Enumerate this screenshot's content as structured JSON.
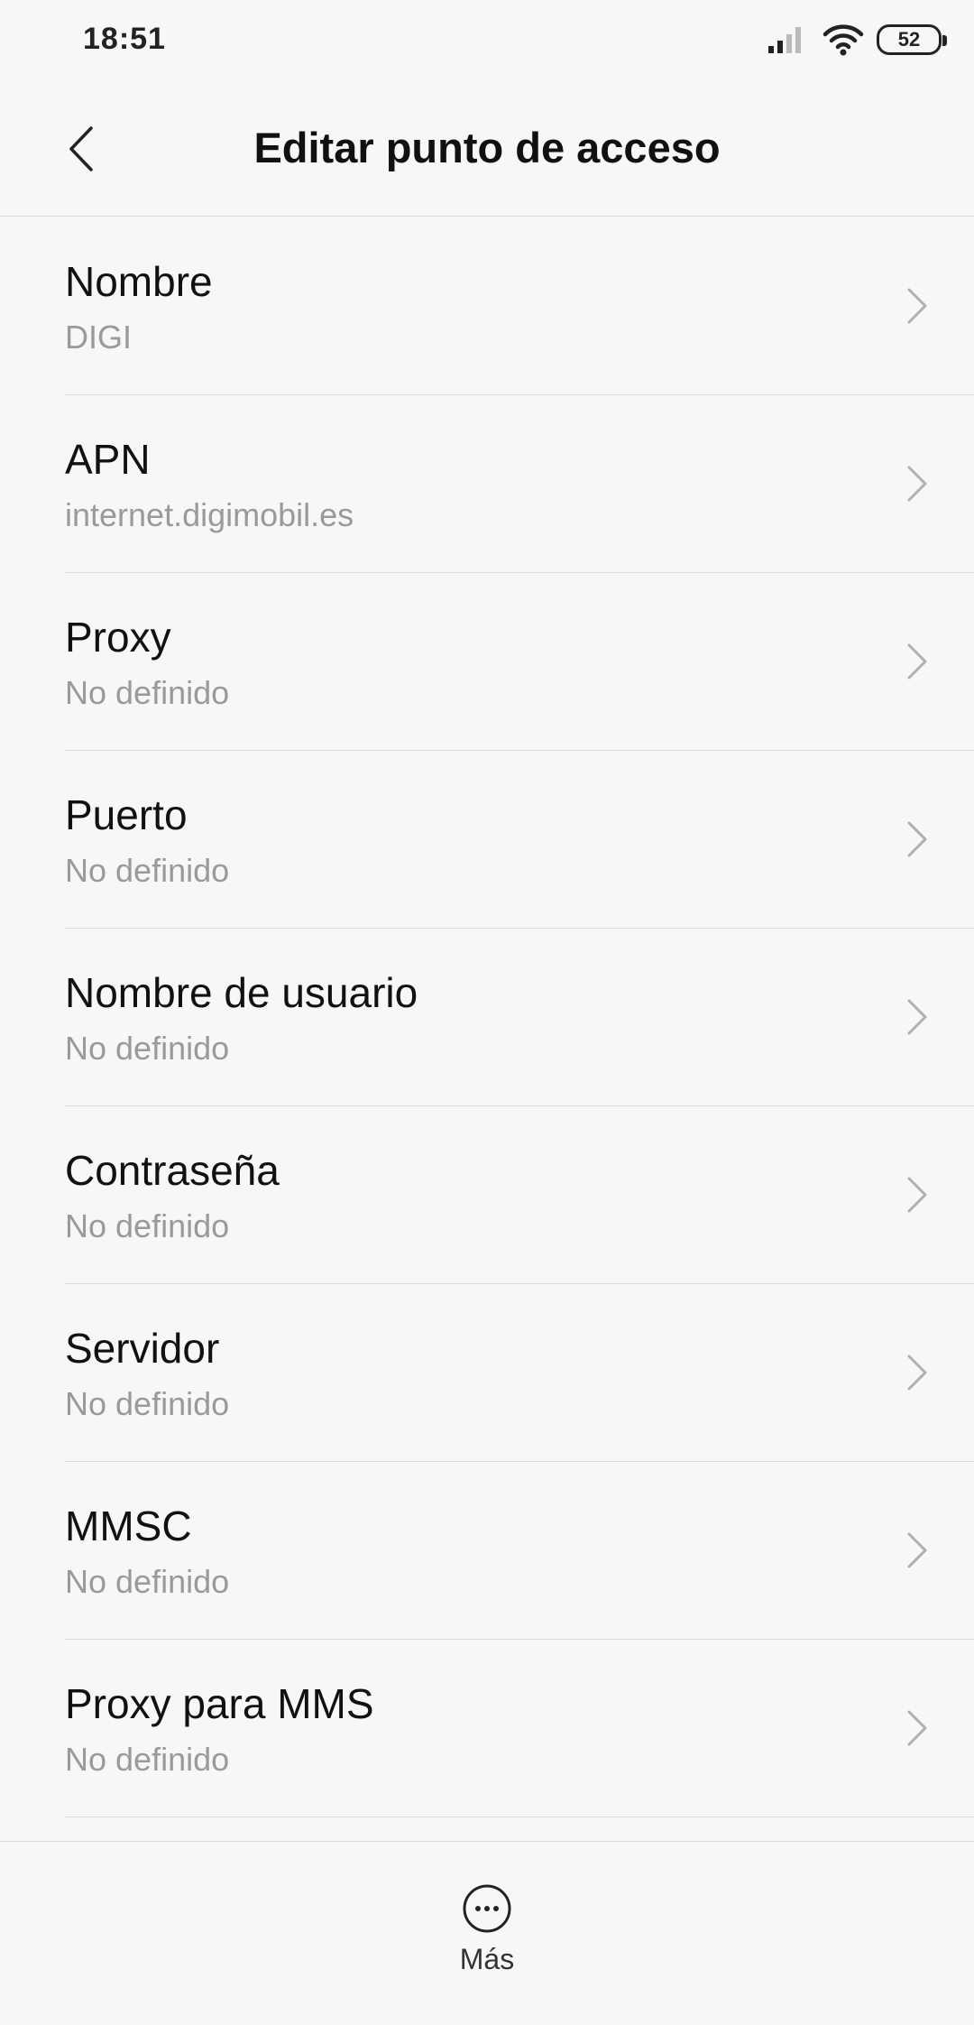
{
  "status_bar": {
    "time": "18:51",
    "battery": "52",
    "icons": [
      "signal-icon",
      "wifi-icon",
      "battery-icon"
    ]
  },
  "header": {
    "title": "Editar punto de acceso",
    "back_icon": "chevron-left-icon"
  },
  "items": [
    {
      "label": "Nombre",
      "value": "DIGI"
    },
    {
      "label": "APN",
      "value": "internet.digimobil.es"
    },
    {
      "label": "Proxy",
      "value": "No definido"
    },
    {
      "label": "Puerto",
      "value": "No definido"
    },
    {
      "label": "Nombre de usuario",
      "value": "No definido"
    },
    {
      "label": "Contraseña",
      "value": "No definido"
    },
    {
      "label": "Servidor",
      "value": "No definido"
    },
    {
      "label": "MMSC",
      "value": "No definido"
    },
    {
      "label": "Proxy para MMS",
      "value": "No definido"
    }
  ],
  "bottom_bar": {
    "more_label": "Más",
    "more_icon": "more-icon"
  },
  "colors": {
    "background": "#f7f7f7",
    "primary_text": "#111111",
    "secondary_text": "#9a9a9a",
    "divider": "#dcdcdc",
    "chevron": "#b0b0b0"
  }
}
